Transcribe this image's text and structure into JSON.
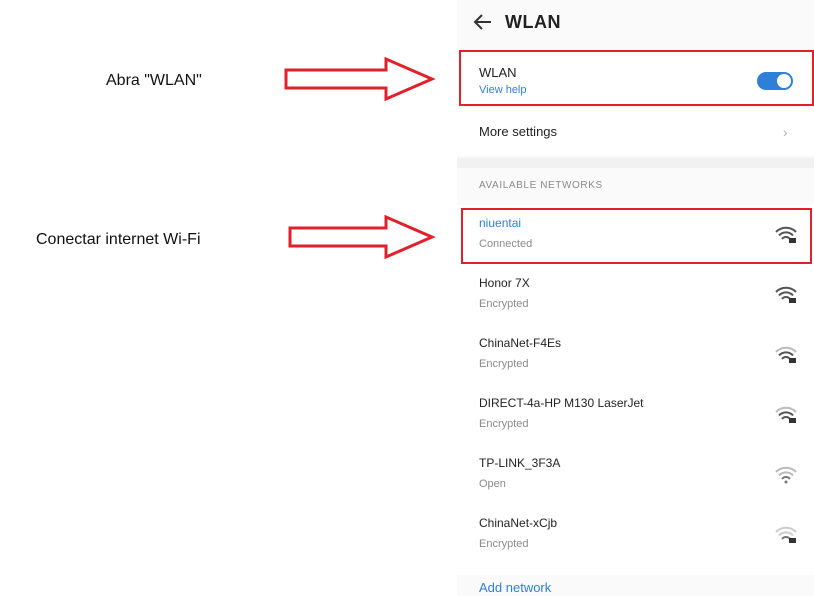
{
  "annotations": {
    "open_wlan": "Abra \"WLAN\"",
    "connect_wifi": "Conectar internet Wi-Fi",
    "highlight_color": "#e0202a"
  },
  "header": {
    "back_icon": "arrow-left-icon",
    "title": "WLAN"
  },
  "wlan_toggle": {
    "label": "WLAN",
    "help_link": "View help",
    "enabled": true,
    "accent": "#2f7ed8"
  },
  "more_settings": {
    "label": "More settings",
    "icon": "chevron-right-icon"
  },
  "networks": {
    "section_label": "AVAILABLE NETWORKS",
    "items": [
      {
        "name": "niuentai",
        "status": "Connected"
      },
      {
        "name": "Honor 7X",
        "status": "Encrypted"
      },
      {
        "name": "ChinaNet-F4Es",
        "status": "Encrypted"
      },
      {
        "name": "DIRECT-4a-HP M130 LaserJet",
        "status": "Encrypted"
      },
      {
        "name": "TP-LINK_3F3A",
        "status": "Open"
      },
      {
        "name": "ChinaNet-xCjb",
        "status": "Encrypted"
      }
    ]
  },
  "add_network": "Add network"
}
